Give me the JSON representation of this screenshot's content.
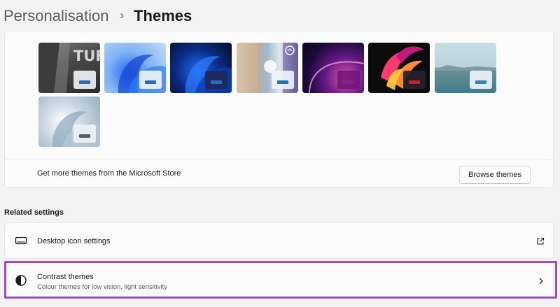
{
  "breadcrumb": {
    "parent": "Personalisation",
    "separator": "›",
    "current": "Themes"
  },
  "themes": [
    {
      "name": "tuf-theme",
      "accent": "#1f6fc5"
    },
    {
      "name": "windows-light-theme",
      "accent": "#1f6fc5"
    },
    {
      "name": "windows-dark-theme",
      "accent": "#1f6fc5"
    },
    {
      "name": "glow-theme",
      "accent": "#1f6fc5"
    },
    {
      "name": "captured-motion-theme",
      "accent": "#8a1f8f"
    },
    {
      "name": "flow-theme",
      "accent": "#d11a2a"
    },
    {
      "name": "sunrise-theme",
      "accent": "#2b86b6"
    },
    {
      "name": "windows-bloom-theme",
      "accent": "#4f6270"
    }
  ],
  "store": {
    "text": "Get more themes from the Microsoft Store",
    "button_label": "Browse themes"
  },
  "related_settings": {
    "title": "Related settings",
    "items": [
      {
        "label": "Desktop icon settings",
        "icon": "monitor-icon",
        "action_icon": "open-external-icon"
      },
      {
        "label": "Contrast themes",
        "subtitle": "Colour themes for low vision, light sensitivity",
        "icon": "contrast-icon",
        "action_icon": "chevron-right-icon"
      }
    ]
  },
  "colors": {
    "highlight": "#9b4fc0",
    "accent": "#1f6fc5"
  }
}
